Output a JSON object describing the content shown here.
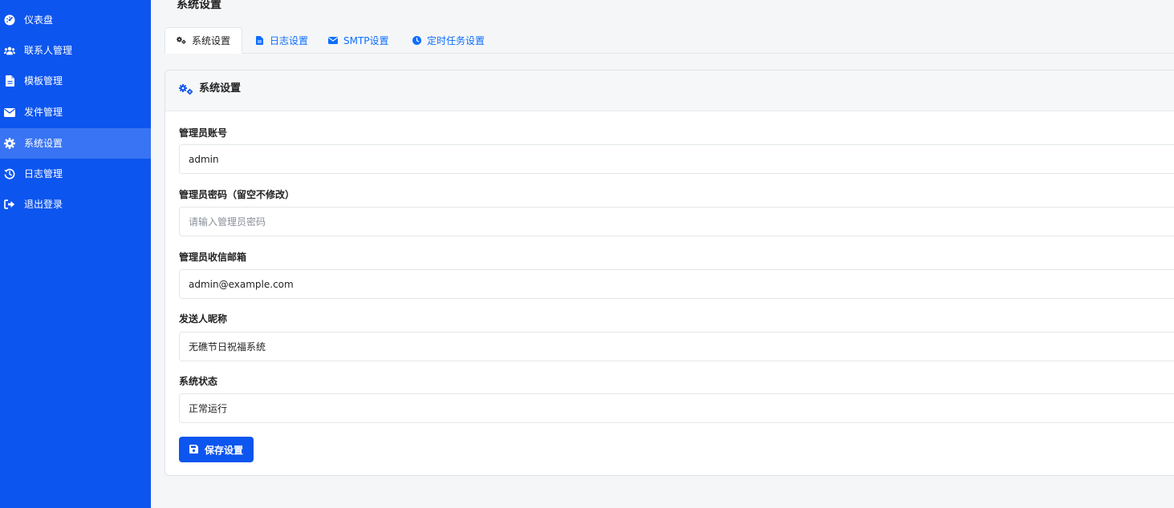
{
  "sidebar": {
    "items": [
      {
        "label": "仪表盘",
        "icon": "dashboard-gauge-icon"
      },
      {
        "label": "联系人管理",
        "icon": "users-icon"
      },
      {
        "label": "模板管理",
        "icon": "file-icon"
      },
      {
        "label": "发件管理",
        "icon": "envelope-icon"
      },
      {
        "label": "系统设置",
        "icon": "gear-icon",
        "active": true
      },
      {
        "label": "日志管理",
        "icon": "history-icon"
      },
      {
        "label": "退出登录",
        "icon": "sign-out-icon"
      }
    ]
  },
  "page": {
    "title": "系统设置"
  },
  "tabs": [
    {
      "label": "系统设置",
      "icon": "gears-icon",
      "active": true
    },
    {
      "label": "日志设置",
      "icon": "file-icon"
    },
    {
      "label": "SMTP设置",
      "icon": "envelope-icon"
    },
    {
      "label": "定时任务设置",
      "icon": "clock-icon"
    }
  ],
  "card": {
    "title": "系统设置",
    "fields": {
      "admin_account": {
        "label": "管理员账号",
        "value": "admin",
        "placeholder": ""
      },
      "admin_password": {
        "label": "管理员密码（留空不修改）",
        "value": "",
        "placeholder": "请输入管理员密码"
      },
      "admin_email": {
        "label": "管理员收信邮箱",
        "value": "admin@example.com",
        "placeholder": ""
      },
      "sender_name": {
        "label": "发送人昵称",
        "value": "无礁节日祝福系统",
        "placeholder": ""
      },
      "system_status": {
        "label": "系统状态",
        "value": "正常运行",
        "placeholder": ""
      }
    },
    "save_label": "保存设置"
  },
  "colors": {
    "primary": "#0d55ef",
    "sidebar_active": "#3874f3",
    "link": "#0d6efd"
  }
}
